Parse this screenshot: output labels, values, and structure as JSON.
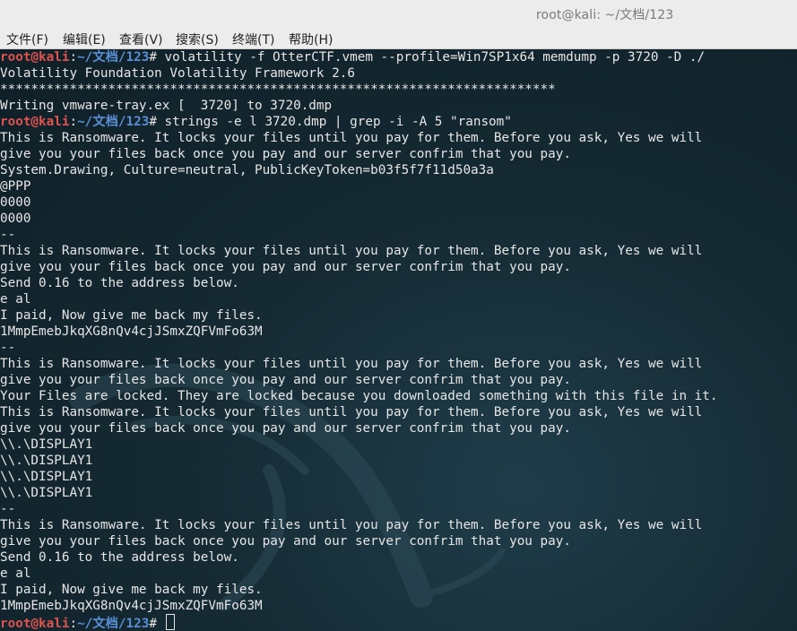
{
  "window": {
    "title": "root@kali: ~/文档/123"
  },
  "menu": [
    {
      "id": "file",
      "label": "文件(F)"
    },
    {
      "id": "edit",
      "label": "编辑(E)"
    },
    {
      "id": "view",
      "label": "查看(V)"
    },
    {
      "id": "search",
      "label": "搜索(S)"
    },
    {
      "id": "terminal",
      "label": "终端(T)"
    },
    {
      "id": "help",
      "label": "帮助(H)"
    }
  ],
  "prompt": {
    "user": "root@kali",
    "colon": ":",
    "path": "~/文档/123",
    "hash": "#"
  },
  "colors": {
    "prompt_user": "#e0524f",
    "prompt_path": "#5a8fd6",
    "text": "#e6e6e6",
    "background": "#152a33"
  },
  "lines": [
    {
      "type": "cmd",
      "text": " volatility -f OtterCTF.vmem --profile=Win7SP1x64 memdump -p 3720 -D ./"
    },
    {
      "type": "out",
      "text": "Volatility Foundation Volatility Framework 2.6"
    },
    {
      "type": "out",
      "text": "************************************************************************"
    },
    {
      "type": "out",
      "text": "Writing vmware-tray.ex [  3720] to 3720.dmp"
    },
    {
      "type": "cmd",
      "text": " strings -e l 3720.dmp | grep -i -A 5 \"ransom\""
    },
    {
      "type": "out",
      "text": "This is Ransomware. It locks your files until you pay for them. Before you ask, Yes we will"
    },
    {
      "type": "out",
      "text": "give you your files back once you pay and our server confrim that you pay."
    },
    {
      "type": "out",
      "text": "System.Drawing, Culture=neutral, PublicKeyToken=b03f5f7f11d50a3a"
    },
    {
      "type": "out",
      "text": "@PPP"
    },
    {
      "type": "out",
      "text": "0000"
    },
    {
      "type": "out",
      "text": "0000"
    },
    {
      "type": "out",
      "text": "--"
    },
    {
      "type": "out",
      "text": "This is Ransomware. It locks your files until you pay for them. Before you ask, Yes we will"
    },
    {
      "type": "out",
      "text": "give you your files back once you pay and our server confrim that you pay."
    },
    {
      "type": "out",
      "text": "Send 0.16 to the address below."
    },
    {
      "type": "out",
      "text": "e al"
    },
    {
      "type": "out",
      "text": "I paid, Now give me back my files."
    },
    {
      "type": "out",
      "text": "1MmpEmebJkqXG8nQv4cjJSmxZQFVmFo63M"
    },
    {
      "type": "out",
      "text": "--"
    },
    {
      "type": "out",
      "text": "This is Ransomware. It locks your files until you pay for them. Before you ask, Yes we will"
    },
    {
      "type": "out",
      "text": "give you your files back once you pay and our server confrim that you pay."
    },
    {
      "type": "out",
      "text": "Your Files are locked. They are locked because you downloaded something with this file in it."
    },
    {
      "type": "out",
      "text": "This is Ransomware. It locks your files until you pay for them. Before you ask, Yes we will"
    },
    {
      "type": "out",
      "text": "give you your files back once you pay and our server confrim that you pay."
    },
    {
      "type": "out",
      "text": "\\\\.\\DISPLAY1"
    },
    {
      "type": "out",
      "text": "\\\\.\\DISPLAY1"
    },
    {
      "type": "out",
      "text": "\\\\.\\DISPLAY1"
    },
    {
      "type": "out",
      "text": "\\\\.\\DISPLAY1"
    },
    {
      "type": "out",
      "text": "--"
    },
    {
      "type": "out",
      "text": "This is Ransomware. It locks your files until you pay for them. Before you ask, Yes we will"
    },
    {
      "type": "out",
      "text": "give you your files back once you pay and our server confrim that you pay."
    },
    {
      "type": "out",
      "text": "Send 0.16 to the address below."
    },
    {
      "type": "out",
      "text": "e al"
    },
    {
      "type": "out",
      "text": "I paid, Now give me back my files."
    },
    {
      "type": "out",
      "text": "1MmpEmebJkqXG8nQv4cjJSmxZQFVmFo63M"
    },
    {
      "type": "prompt",
      "text": " "
    }
  ]
}
